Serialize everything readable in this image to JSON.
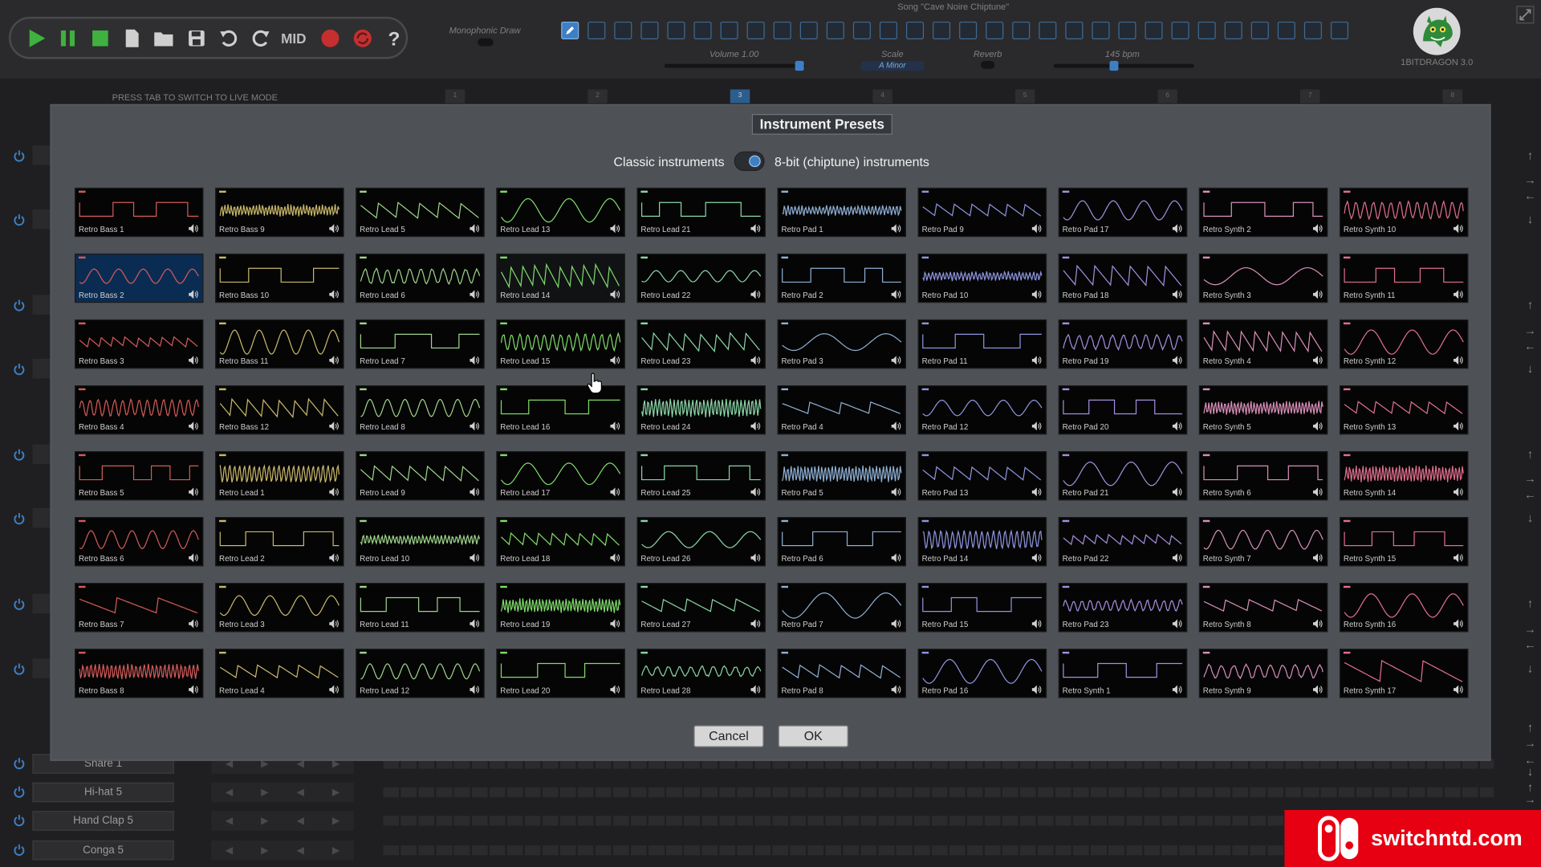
{
  "toolbar": {
    "icons": [
      "play-icon",
      "pause-icon",
      "stop-icon",
      "new-file-icon",
      "open-folder-icon",
      "save-icon",
      "undo-icon",
      "redo-icon"
    ],
    "mid_label": "MID",
    "icons_after": [
      "record-icon",
      "refresh-icon",
      "help-icon"
    ]
  },
  "header": {
    "monophonic_label": "Monophonic Draw",
    "song_title": "Song \"Cave Noire Chiptune\"",
    "volume_label": "Volume 1.00",
    "scale_label": "Scale",
    "scale_value": "A Minor",
    "reverb_label": "Reverb",
    "bpm_label": "145 bpm",
    "version": "1BITDRAGON 3.0"
  },
  "live_mode_hint": "PRESS TAB TO SWITCH TO LIVE MODE",
  "beats": [
    "1",
    "2",
    "3",
    "4",
    "5",
    "6",
    "7",
    "8"
  ],
  "tracks": [
    {
      "name": "Snare 1"
    },
    {
      "name": "Hi-hat 5"
    },
    {
      "name": "Hand Clap 5"
    },
    {
      "name": "Conga 5"
    }
  ],
  "dialog": {
    "title": "Instrument Presets",
    "toggle_left": "Classic instruments",
    "toggle_right": "8-bit (chiptune) instruments",
    "cancel_label": "Cancel",
    "ok_label": "OK",
    "columns": [
      {
        "color": "#d45a5a",
        "names": [
          "Retro Bass 1",
          "Retro Bass 2",
          "Retro Bass 3",
          "Retro Bass 4",
          "Retro Bass 5",
          "Retro Bass 6",
          "Retro Bass 7",
          "Retro Bass 8"
        ]
      },
      {
        "color": "#c9b86a",
        "names": [
          "Retro Bass 9",
          "Retro Bass 10",
          "Retro Bass 11",
          "Retro Bass 12",
          "Retro Lead 1",
          "Retro Lead 2",
          "Retro Lead 3",
          "Retro Lead 4"
        ]
      },
      {
        "color": "#9ed48a",
        "names": [
          "Retro Lead 5",
          "Retro Lead 6",
          "Retro Lead 7",
          "Retro Lead 8",
          "Retro Lead 9",
          "Retro Lead 10",
          "Retro Lead 11",
          "Retro Lead 12"
        ]
      },
      {
        "color": "#7fdc6a",
        "names": [
          "Retro Lead 13",
          "Retro Lead 14",
          "Retro Lead 15",
          "Retro Lead 16",
          "Retro Lead 17",
          "Retro Lead 18",
          "Retro Lead 19",
          "Retro Lead 20"
        ]
      },
      {
        "color": "#8ad6a8",
        "names": [
          "Retro Lead 21",
          "Retro Lead 22",
          "Retro Lead 23",
          "Retro Lead 24",
          "Retro Lead 25",
          "Retro Lead 26",
          "Retro Lead 27",
          "Retro Lead 28"
        ]
      },
      {
        "color": "#8fb0d4",
        "names": [
          "Retro Pad 1",
          "Retro Pad 2",
          "Retro Pad 3",
          "Retro Pad 4",
          "Retro Pad 5",
          "Retro Pad 6",
          "Retro Pad 7",
          "Retro Pad 8"
        ]
      },
      {
        "color": "#8f95e0",
        "names": [
          "Retro Pad 9",
          "Retro Pad 10",
          "Retro Pad 11",
          "Retro Pad 12",
          "Retro Pad 13",
          "Retro Pad 14",
          "Retro Pad 15",
          "Retro Pad 16"
        ]
      },
      {
        "color": "#a58fe0",
        "names": [
          "Retro Pad 17",
          "Retro Pad 18",
          "Retro Pad 19",
          "Retro Pad 20",
          "Retro Pad 21",
          "Retro Pad 22",
          "Retro Pad 23",
          "Retro Synth 1"
        ]
      },
      {
        "color": "#d88fb8",
        "names": [
          "Retro Synth 2",
          "Retro Synth 3",
          "Retro Synth 4",
          "Retro Synth 5",
          "Retro Synth 6",
          "Retro Synth 7",
          "Retro Synth 8",
          "Retro Synth 9"
        ]
      },
      {
        "color": "#e06f8f",
        "names": [
          "Retro Synth 10",
          "Retro Synth 11",
          "Retro Synth 12",
          "Retro Synth 13",
          "Retro Synth 14",
          "Retro Synth 15",
          "Retro Synth 16",
          "Retro Synth 17"
        ]
      }
    ],
    "selected": "Retro Bass 2",
    "hovered": "Retro Lead 14"
  },
  "watermark": {
    "text": "switchntd.com",
    "color": "#e60012"
  }
}
